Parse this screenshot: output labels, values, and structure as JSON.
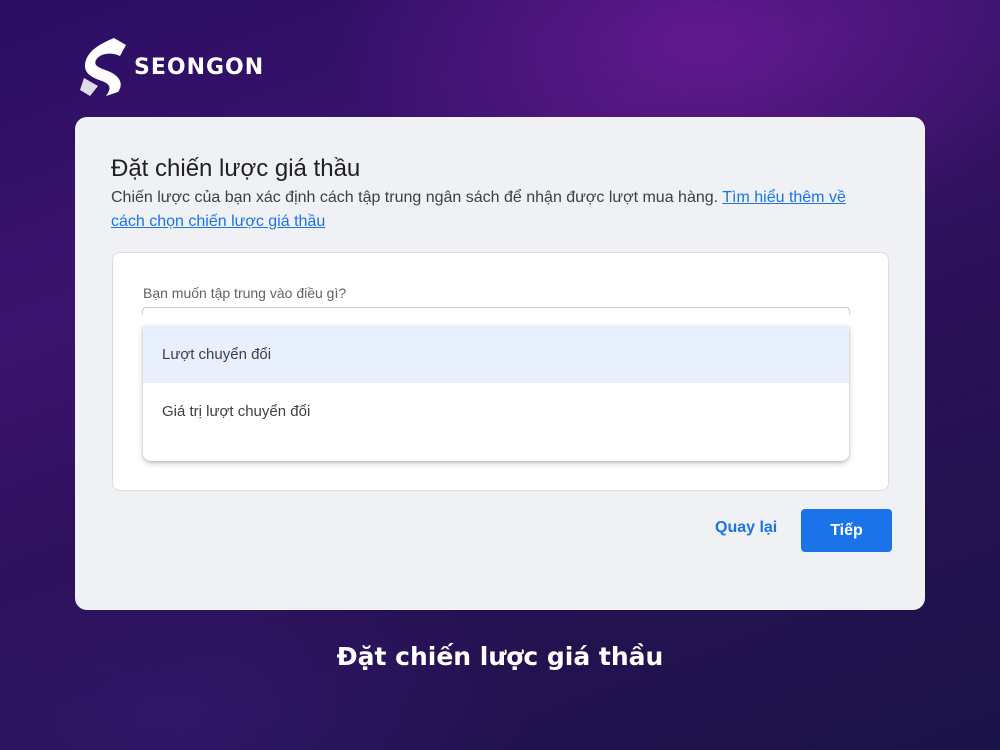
{
  "brand": {
    "name": "SEONGON",
    "logo_icon": "seongon-s-logo-icon"
  },
  "dialog": {
    "title": "Đặt chiến lược giá thầu",
    "description": "Chiến lược của bạn xác định cách tập trung ngân sách để nhận được lượt mua hàng.",
    "learn_more_link": "Tìm hiểu thêm về cách chọn chiến lược giá thầu",
    "question": "Bạn muốn tập trung vào điều gì?",
    "options": [
      {
        "label": "Lượt chuyển đổi",
        "selected": true
      },
      {
        "label": "Giá trị lượt chuyển đổi",
        "selected": false
      }
    ],
    "back_button": "Quay lại",
    "next_button": "Tiếp"
  },
  "caption": "Đặt chiến lược giá thầu",
  "colors": {
    "accent": "#1a73e8",
    "selected_option_bg": "#e8f0fe",
    "card_bg": "#f0f1f5",
    "background": "#2a0e63"
  }
}
